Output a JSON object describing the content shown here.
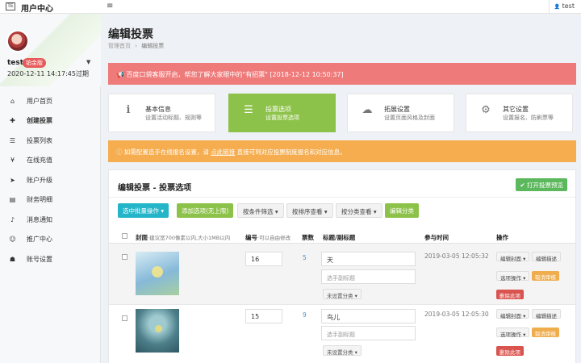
{
  "topbar": {
    "logo_text": "TE",
    "app_title": "用户中心",
    "hamburger": "≡",
    "user_label": "test",
    "user_icon": "👤"
  },
  "sidebar": {
    "username": "test",
    "badge": "铂金版",
    "expire": "2020-12-11 14:17:45过期",
    "items": [
      {
        "icon": "home-icon",
        "glyph": "⌂",
        "label": "用户首页"
      },
      {
        "icon": "plus-icon",
        "glyph": "✚",
        "label": "创建投票"
      },
      {
        "icon": "list-icon",
        "glyph": "☰",
        "label": "投票列表"
      },
      {
        "icon": "yen-icon",
        "glyph": "¥",
        "label": "在线充值"
      },
      {
        "icon": "send-icon",
        "glyph": "➤",
        "label": "账户升级"
      },
      {
        "icon": "database-icon",
        "glyph": "▤",
        "label": "财务明细"
      },
      {
        "icon": "bell-icon",
        "glyph": "♪",
        "label": "消息通知"
      },
      {
        "icon": "user-plus-icon",
        "glyph": "☺",
        "label": "推广中心"
      },
      {
        "icon": "user-icon",
        "glyph": "☗",
        "label": "账号设置"
      }
    ]
  },
  "main": {
    "page_title": "编辑投票",
    "breadcrumb": {
      "home": "管理首页",
      "sep": "›",
      "current": "编辑投票"
    },
    "alert_red": "百度口袋客服开启，帮您了解大家眼中的\"有招票\" [2018-12-12 10:50:37]",
    "steps": [
      {
        "icon": "info-icon",
        "glyph": "i",
        "title": "基本信息",
        "sub": "设置活动标题、规则等"
      },
      {
        "icon": "list-icon",
        "glyph": "☰",
        "title": "投票选项",
        "sub": "设置投票选项"
      },
      {
        "icon": "cloud-icon",
        "glyph": "☁",
        "title": "拓展设置",
        "sub": "设置页面风格及封面"
      },
      {
        "icon": "gear-icon",
        "glyph": "⚙",
        "title": "其它设置",
        "sub": "设置报名、防刷票等"
      }
    ],
    "alert_yellow": {
      "icon": "ⓘ",
      "before": "如需配置选手在线报名设置，请",
      "link": "点此链接",
      "after": "直接可到对应投票制度报名和对应信息。"
    },
    "panel": {
      "title": "编辑投票 - 投票选项",
      "preview_btn": "✔ 打开投票预览",
      "toolbar": {
        "batch": "选中批量操作 ▾",
        "add": "添加选项(无上限)",
        "filter": "按条件筛选 ▾",
        "sort": "按排序查看 ▾",
        "category": "按分类查看 ▾",
        "edit_cat": "编辑分类"
      },
      "headers": {
        "cover": "封面",
        "cover_hint": "·建议宽700像素以内,大小1MB以内",
        "number": "编号",
        "number_hint": "·可以自由修改",
        "votes": "票数",
        "title": "标题/副标题",
        "time": "参与时间",
        "ops": "操作"
      },
      "rows": [
        {
          "number": "16",
          "votes": "5",
          "title": "天",
          "subtitle": "选手副标题",
          "category": "未设置分类 ▾",
          "time": "2019-03-05 12:05:32",
          "ops": {
            "cover": "编辑封面 ▾",
            "desc": "编辑描述",
            "option": "选项操作 ▾",
            "review": "取消审核",
            "delete": "删除此项"
          }
        },
        {
          "number": "15",
          "votes": "9",
          "title": "鸟儿",
          "subtitle": "选手副标题",
          "category": "未设置分类 ▾",
          "time": "2019-03-05 12:05:30",
          "ops": {
            "cover": "编辑封面 ▾",
            "desc": "编辑描述",
            "option": "选项操作 ▾",
            "review": "取消审核",
            "delete": "删除此项"
          }
        }
      ]
    }
  },
  "colors": {
    "green": "#8dc24a",
    "teal": "#25b5c9",
    "red_alert": "#ef7a7a",
    "yellow_alert": "#f5ad4f"
  }
}
